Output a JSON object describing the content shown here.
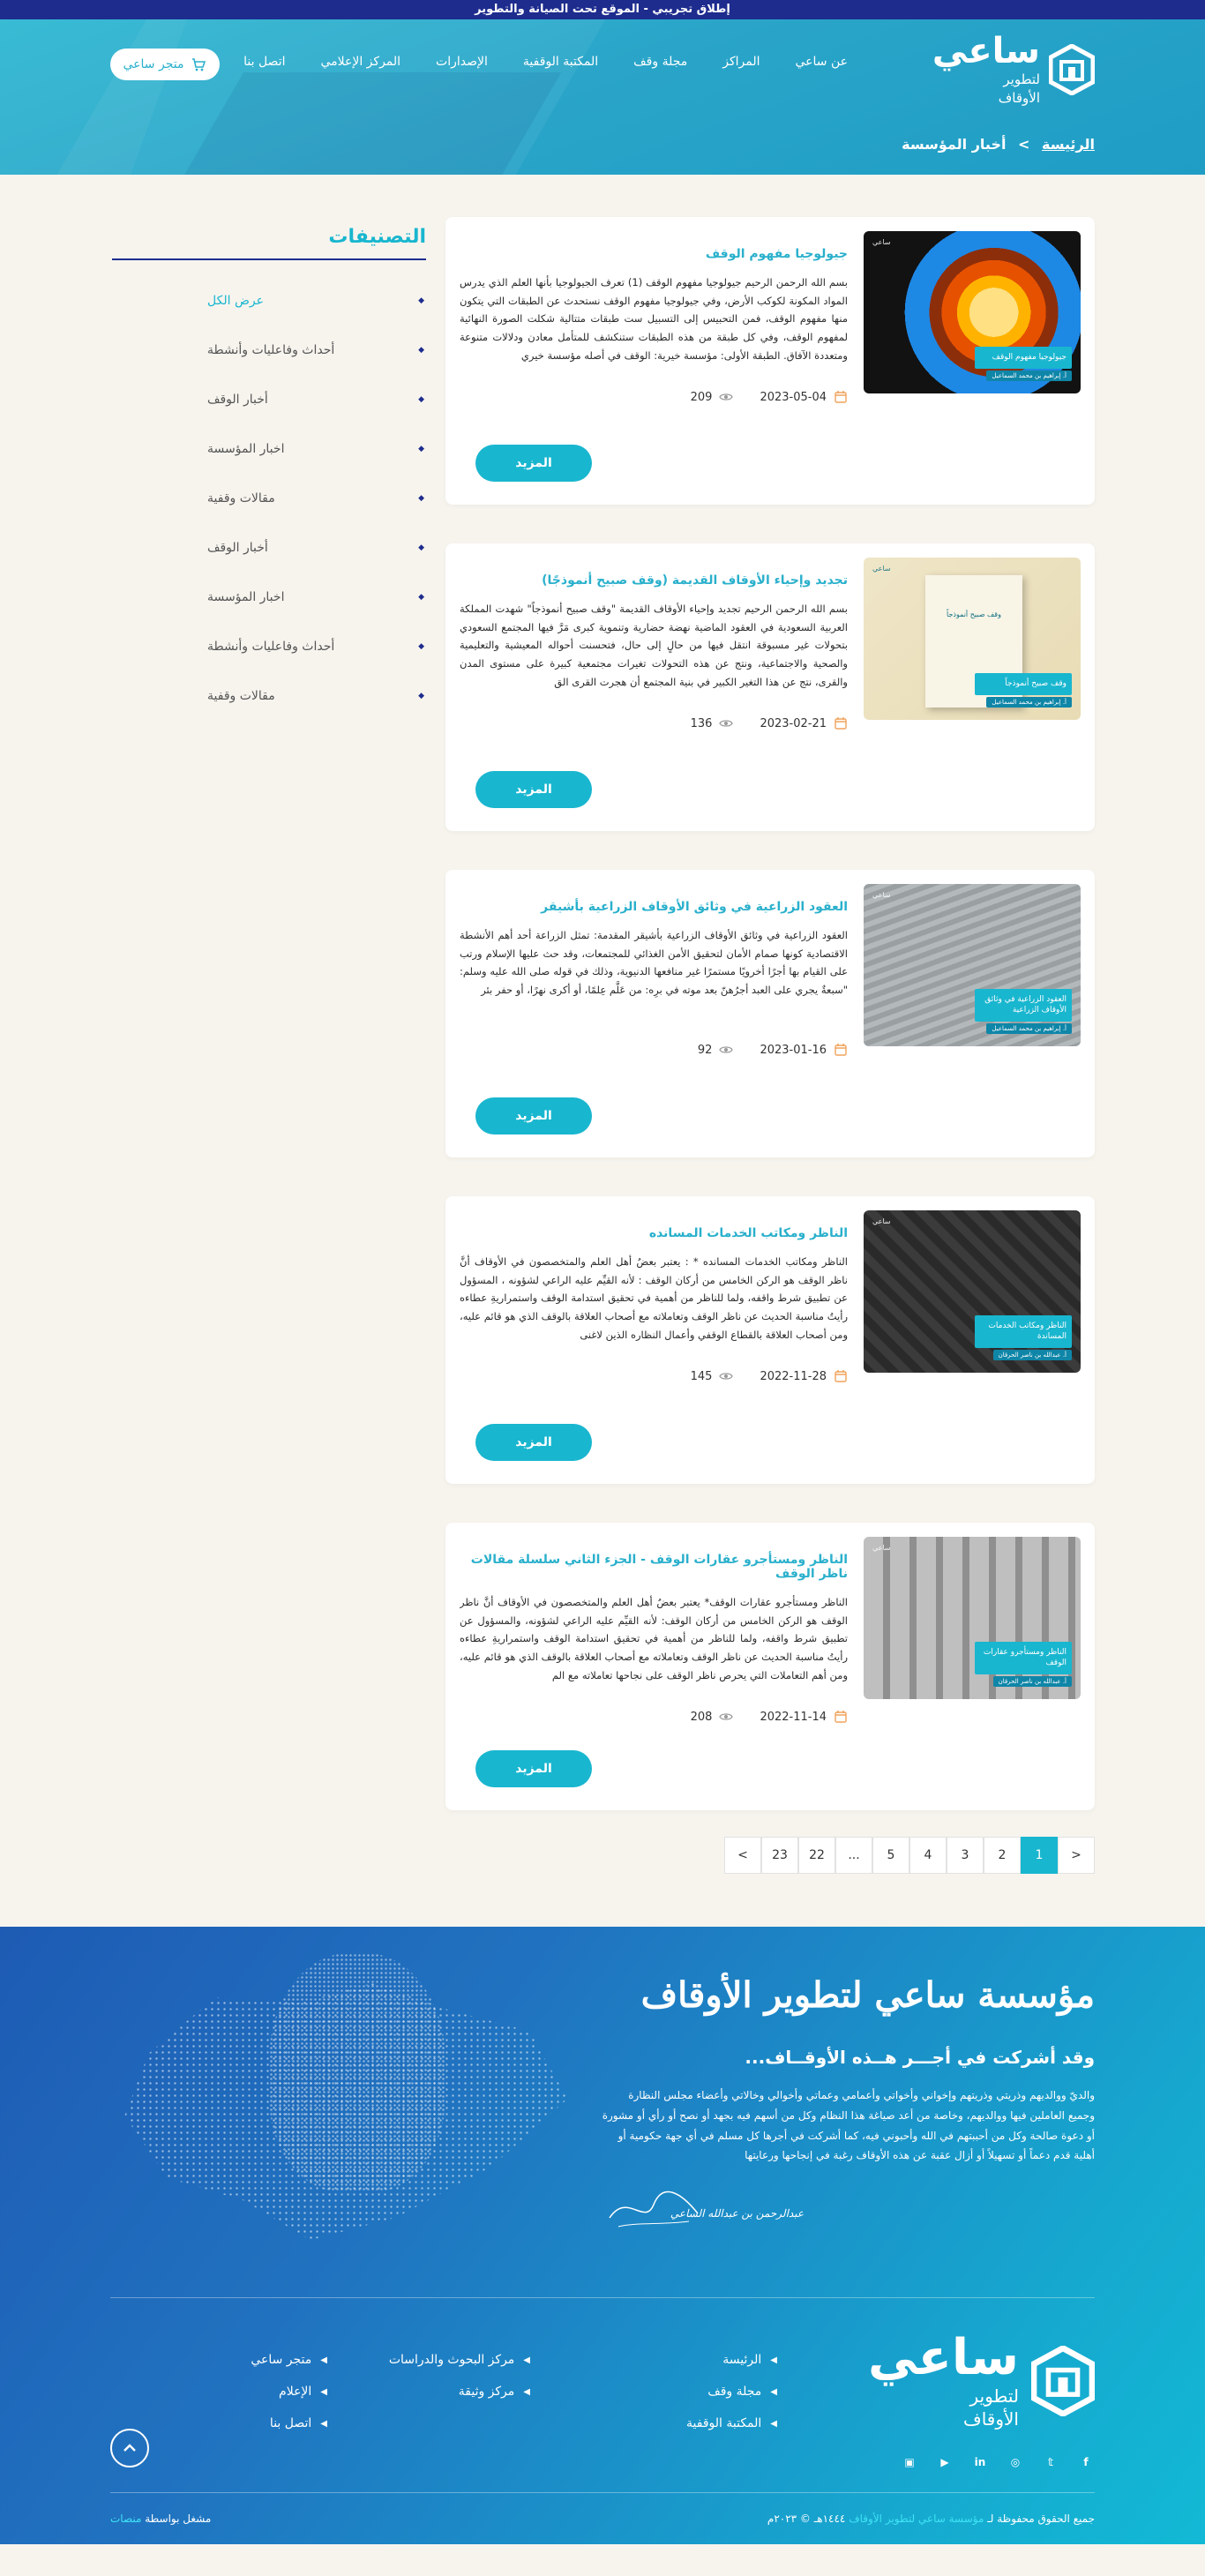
{
  "topbar": {
    "notice": "إطلاق تجريبي - الموقع تحت الصيانة والتطوير"
  },
  "header": {
    "logo": {
      "name": "ساعي",
      "line1": "لتطوير",
      "line2": "الأوقاف"
    },
    "nav": [
      "عن ساعي",
      "المراكز",
      "مجلة وقف",
      "المكتبة الوقفية",
      "الإصدارات",
      "المركز الإعلامي",
      "اتصل بنا"
    ],
    "store_label": "متجر ساعي",
    "breadcrumb": {
      "home": "الرئيسة",
      "separator": ">",
      "current": "أخبار المؤسسة"
    }
  },
  "articles": [
    {
      "title": "جيولوجيا مفهوم الوقف",
      "text": "بسم الله الرحمن الرحيم   جيولوجيا مفهوم الوقف (1)   تعرف الجيولوجيا بأنها العلم الذي يدرس المواد المكونة لكوكب الأرض، وفي جيولوجيا مفهوم الوقف نستحدث عن الطبقات التي يتكون منها مفهوم الوقف، فمن التحبيس إلى التسبيل ست طبقات متتالية شكلت الصورة النهائية لمفهوم الوقف، وفي كل طبقة من هذه الطبقات ستنكشف للمتأمل معادن ودلالات متنوعة ومتعددة الآفاق. الطبقة الأولى: مؤسسة خيرية: الوقف في أصله مؤسسة خيري",
      "date": "2023-05-04",
      "views": "209",
      "image_caption": "جيولوجيا مفهوم الوقف",
      "image_author": "أ. إبراهيم بن محمد السماعيل"
    },
    {
      "title": "تجديد وإحياء الأوقاف القديمة (وقف صبيح أنموذجًا)",
      "text": "بسم الله الرحمن الرحيم   تجديد وإحياء الأوقاف القديمة \"وقف صبيح أنموذجاً\"   شهدت المملكة العربية السعودية في العقود الماضية نهضة حضارية وتنموية كبرى مَرَّ فيها المجتمع السعودي بتحولات غير مسبوقة انتقل فيها من حالٍ إلى حال، فتحسنت أحواله المعيشية والتعليمية والصحية والاجتماعية، ونتج عن هذه التحولات تغيرات مجتمعية كبيرة على مستوى المدن والقرى، نتج عن هذا التغير الكبير في بنية المجتمع أن هجرت القرى الق",
      "date": "2023-02-21",
      "views": "136",
      "image_caption": "وقف صبيح أنموذجاً",
      "image_author": "أ. إبراهيم بن محمد السماعيل"
    },
    {
      "title": "العقود الزراعية في وثائق الأوقاف الزراعية بأشيقر",
      "text": "العقود الزراعية في وثائق الأوقاف الزراعية بأشيقر المقدمة: تمثل الزراعة أحد أهم الأنشطة الاقتصادية كونها صمام الأمان لتحقيق الأمن الغذائي للمجتمعات، وقد حث عليها الإسلام ورتب على القيام بها أجرًا أخرويًا مستمرًا غير منافعها الدنيوية، وذلك في قوله صلى الله عليه وسلم: \"سبعةٌ يجري على العبد أجرُهنّ بعد موته في برِه: من عَلَّم عِلمًا، أو أكرى نهرًا، أو حفر بئر",
      "date": "2023-01-16",
      "views": "92",
      "image_caption": "العقود الزراعية في وثائق الأوقاف الزراعية",
      "image_author": "أ. إبراهيم بن محمد السماعيل"
    },
    {
      "title": "الناظر ومكاتب الخدمات المسانده",
      "text": "الناظر ومكاتب الخدمات المسانده * : يعتبر بعضُ أهل العلم والمتخصصون في الأوقاف أنَّ ناظر الوقف هو الركن الخامس من أركان الوقف : لأنه القيِّم عليه الراعي لشؤونه ، المسؤول عن تطبيق شرط واقفه، ولما للناظر من أهمية في تحقيق استدامة الوقف واستمراريةِ عطاءه رأيتُ مناسبة الحديث عن ناظر الوقف وتعاملاته مع أصحاب العلاقة بالوقف الذي هو قائم عليه، ومن أصحاب العلاقة بالقطاع الوقفي وأعمال النظاره الذين لاغنى",
      "date": "2022-11-28",
      "views": "145",
      "image_caption": "الناظر ومكاتب الخدمات المساندة",
      "image_author": "أ. عبدالله بن ناصر الحرقان"
    },
    {
      "title": "الناظر ومستأجرو عقارات الوقف - الجزء الثاني سلسلة مقالات ناظر الوقف",
      "text": "الناظر ومستأجرو عقارات الوقف*   يعتبر بعضُ أهل العلم والمتخصصون في الأوقاف أنَّ ناظر الوقف هو الركن الخامس من أركان الوقف: لأنه القيِّم عليه الراعي لشؤونه، والمسؤول عن تطبيق شرط واقفه، ولما للناظر من أهمية في تحقيق استدامة الوقف واستمراريةِ عطاءه رأيتُ مناسبة الحديث عن ناظر الوقف وتعاملاته مع أصحاب العلاقة بالوقف الذي هو قائم عليه، ومن أهم التعاملات التي يحرص ناظر الوقف على نجاحها تعاملاته مع الم",
      "date": "2022-11-14",
      "views": "208",
      "image_caption": "الناظر ومستأجرو عقارات الوقف",
      "image_author": "أ. عبدالله بن ناصر الحرقان"
    }
  ],
  "more_label": "المزيد",
  "image_brand": "ساعي",
  "sidebar": {
    "title": "التصنيفات",
    "items": [
      "عرض الكل",
      "أحداث وفاعليات وأنشطة",
      "أخبار الوقف",
      "اخبار المؤسسة",
      "مقالات وقفية",
      "أخبار الوقف",
      "اخبار المؤسسة",
      "أحداث وفاعليات وأنشطة",
      "مقالات وقفية"
    ]
  },
  "pagination": [
    "<",
    "1",
    "2",
    "3",
    "4",
    "5",
    "...",
    "22",
    "23",
    ">"
  ],
  "footer": {
    "brand": "مؤسسة ساعي لتطوير الأوقاف",
    "subtitle": "وقد أشركت في أجـــر هــذه الأوقــاف...",
    "text": "والديّ ووالديهم وذريتي وذريتهم وإخواني وأخواتي وأعمامي وعماتي وأخوالي وخالاتي وأعضاء مجلس النظارة وجميع العاملين فيها ووالديهم، وخاصة من أعد صياغة هذا النظام وكل من أسهم فيه بجهد أو نصح أو رأي أو مشورة أو دعوة صالحة وكل من أحببتهم في الله وأحبوني فيه، كما أشركت في أجرها كل مسلم في أي جهة حكومية أو أهلية قدم دعماً أو تسهيلاً أو أزال عقبة عن هذه الأوقاف رغبة في إنجاحها ورعايتها",
    "signature_name": "عبدالرحمن بن عبدالله الساعي",
    "logo": {
      "name": "ساعي",
      "line1": "لتطوير",
      "line2": "الأوقاف"
    },
    "links_col1": [
      "الرئيسة",
      "مجلة وقف",
      "المكتبة الوقفية"
    ],
    "links_col2": [
      "مركز البحوث والدراسات",
      "مركز وثيقة"
    ],
    "links_col3": [
      "متجر ساعي",
      "الإعلام",
      "اتصل بنا"
    ],
    "socials": [
      "facebook-icon",
      "twitter-icon",
      "instagram-icon",
      "linkedin-icon",
      "youtube-icon",
      "snapchat-icon"
    ],
    "copyright_prefix": "جميع الحقوق محفوظة لـ",
    "copyright_org": "مؤسسة ساعي لتطوير الأوقاف",
    "copyright_year": "١٤٤٤هـ © ٢٠٢٣م",
    "powered_prefix": "مشغل بواسطة",
    "powered_by": "منصات"
  }
}
